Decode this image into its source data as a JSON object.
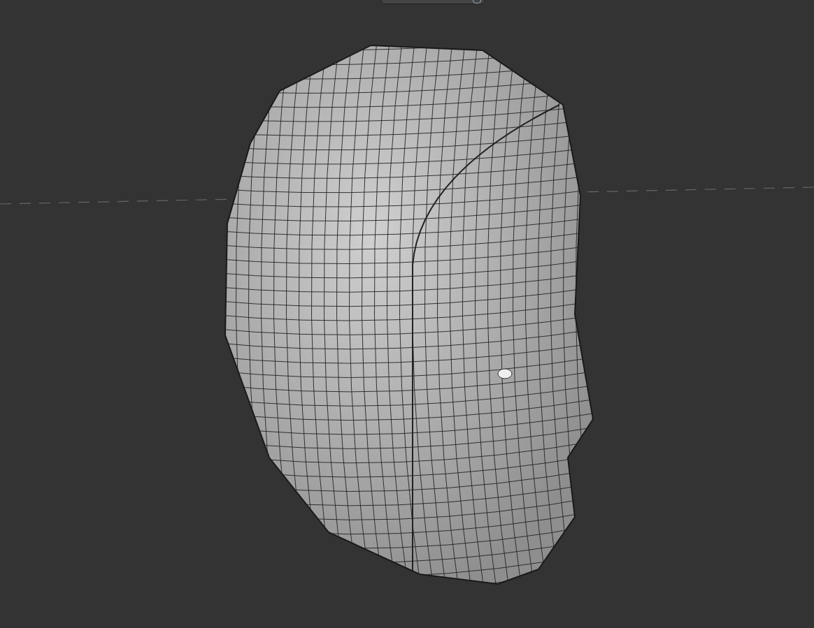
{
  "viewport": {
    "show_horizon": true,
    "show_camera_tab": true
  }
}
